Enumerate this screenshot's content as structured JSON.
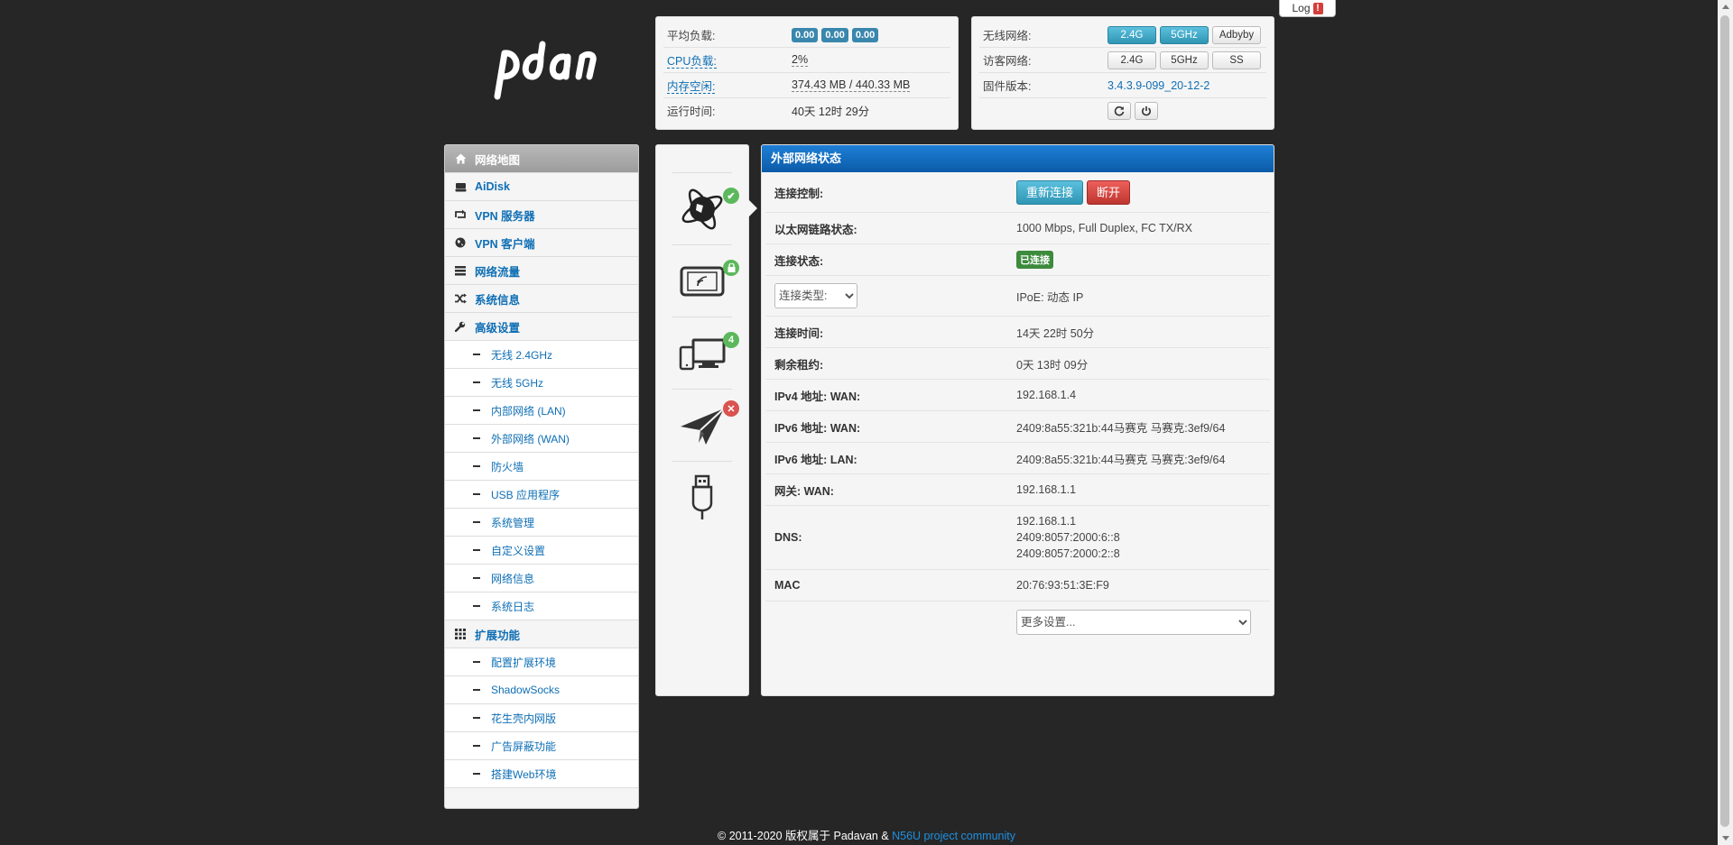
{
  "header": {
    "log_label": "Log",
    "log_alert": "!"
  },
  "sys_status": {
    "load_label": "平均负载:",
    "load_values": [
      "0.00",
      "0.00",
      "0.00"
    ],
    "cpu_label": "CPU负载:",
    "cpu_value": "2%",
    "mem_label": "内存空闲:",
    "mem_value": "374.43 MB / 440.33 MB",
    "uptime_label": "运行时间:",
    "uptime_value": "40天 12时 29分"
  },
  "net_status": {
    "wifi_label": "无线网络:",
    "wifi_buttons": [
      "2.4G",
      "5GHz",
      "Adbyby"
    ],
    "guest_label": "访客网络:",
    "guest_buttons": [
      "2.4G",
      "5GHz",
      "SS"
    ],
    "firmware_label": "固件版本:",
    "firmware_value": "3.4.3.9-099_20-12-2"
  },
  "sidebar": {
    "network_map": "网络地图",
    "aidisk": "AiDisk",
    "vpn_server": "VPN 服务器",
    "vpn_client": "VPN 客户端",
    "traffic": "网络流量",
    "sysinfo": "系统信息",
    "advanced": "高级设置",
    "advanced_items": [
      "无线 2.4GHz",
      "无线 5GHz",
      "内部网络 (LAN)",
      "外部网络 (WAN)",
      "防火墙",
      "USB 应用程序",
      "系统管理",
      "自定义设置",
      "网络信息",
      "系统日志"
    ],
    "extensions": "扩展功能",
    "extension_items": [
      "配置扩展环境",
      "ShadowSocks",
      "花生壳内网版",
      "广告屏蔽功能",
      "搭建Web环境"
    ]
  },
  "iconcol": {
    "clients_count": "4"
  },
  "main": {
    "title": "外部网络状态",
    "rows": {
      "control_label": "连接控制:",
      "reconnect_btn": "重新连接",
      "disconnect_btn": "断开",
      "link_label": "以太网链路状态:",
      "link_value": "1000 Mbps, Full Duplex, FC TX/RX",
      "conn_label": "连接状态:",
      "conn_value": "已连接",
      "type_select": "连接类型:",
      "type_value": "IPoE: 动态 IP",
      "time_label": "连接时间:",
      "time_value": "14天 22时 50分",
      "lease_label": "剩余租约:",
      "lease_value": "0天 13时 09分",
      "ipv4_label": "IPv4 地址: WAN:",
      "ipv4_value": "192.168.1.4",
      "ipv6wan_label": "IPv6 地址: WAN:",
      "ipv6wan_value": "2409:8a55:321b:44马赛克 马赛克:3ef9/64",
      "ipv6lan_label": "IPv6 地址: LAN:",
      "ipv6lan_value": "2409:8a55:321b:44马赛克 马赛克:3ef9/64",
      "gw_label": "网关: WAN:",
      "gw_value": "192.168.1.1",
      "dns_label": "DNS:",
      "dns_values": [
        "192.168.1.1",
        "2409:8057:2000:6::8",
        "2409:8057:2000:2::8"
      ],
      "mac_label": "MAC",
      "mac_value": "20:76:93:51:3E:F9",
      "more_select": "更多设置..."
    }
  },
  "footer": {
    "text": "© 2011-2020 版权属于 Padavan & ",
    "link": "N56U project community"
  }
}
